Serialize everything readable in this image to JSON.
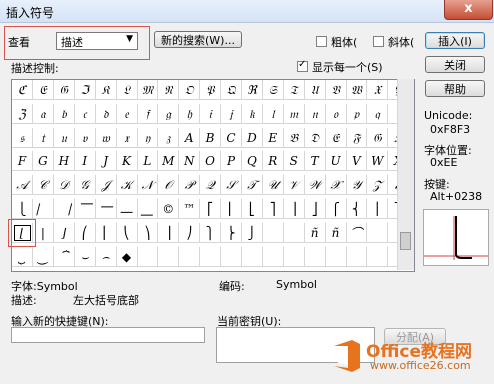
{
  "window": {
    "title": "插入符号",
    "close_glyph": "x"
  },
  "toolbar": {
    "view_label": "查看",
    "view_value": "描述",
    "new_search_label": "新的搜索(W)...",
    "bold_label": "粗体(",
    "italic_label": "斜体(",
    "insert_label": "插入(I)",
    "close_label": "关闭",
    "help_label": "帮助"
  },
  "grid_section": {
    "heading": "描述控制:",
    "show_one_label": "显示每一个(S)",
    "show_one_checked": true,
    "rows": [
      [
        "ℭ",
        "𝔈",
        "𝔊",
        "ℑ",
        "𝔎",
        "𝔏",
        "𝔐",
        "𝔑",
        "𝔒",
        "𝔓",
        "𝔔",
        "ℜ",
        "𝔖",
        "𝔗",
        "𝔘",
        "𝔙",
        "𝔚",
        "𝔛",
        "𝔜"
      ],
      [
        "ℨ",
        "𝔞",
        "𝔟",
        "𝔠",
        "𝔡",
        "𝔢",
        "𝔣",
        "𝔤",
        "𝔥",
        "𝔦",
        "𝔧",
        "𝔨",
        "𝔩",
        "𝔪",
        "𝔫",
        "𝔬",
        "𝔭",
        "𝔮",
        "𝔯"
      ],
      [
        "𝔰",
        "𝔱",
        "𝔲",
        "𝔳",
        "𝔴",
        "𝔵",
        "𝔶",
        "𝔷",
        "A",
        "B",
        "C",
        "D",
        "E",
        "𝔅",
        "𝔇",
        "𝔈",
        "𝔉",
        "𝔊",
        "ℌ"
      ],
      [
        "F",
        "G",
        "H",
        "I",
        "J",
        "K",
        "L",
        "M",
        "N",
        "O",
        "P",
        "Q",
        "R",
        "S",
        "T",
        "U",
        "V",
        "W",
        "X"
      ],
      [
        "𝒜",
        "𝒞",
        "𝒟",
        "𝒢",
        "𝒥",
        "𝒦",
        "𝒩",
        "𝒪",
        "𝒫",
        "𝒬",
        "𝒮",
        "𝒯",
        "𝒰",
        "𝒱",
        "𝒲",
        "𝒳",
        "𝒴",
        "𝒵",
        "𝒶"
      ],
      [
        "⎩",
        "⎸",
        "⎹",
        "⎺",
        "⎻",
        "⎼",
        "⎽",
        "©",
        "™",
        "⎡",
        "⎢",
        "⎣",
        "⎤",
        "⎥",
        "⎦",
        "⎧",
        "⎨",
        "⎪",
        "⎫"
      ],
      [
        "⌊",
        "|",
        "⌋",
        "⎛",
        "⎜",
        "⎝",
        "⎞",
        "⎟",
        "⎠",
        "⎫",
        "⎬",
        "⎭",
        "",
        "",
        "ñ",
        "ñ",
        "⌒",
        "",
        ""
      ],
      [
        "⏟",
        "⏝",
        "⏞",
        "⌣",
        "⌢",
        "◆",
        "",
        "",
        "",
        "",
        "",
        "",
        "",
        "",
        "",
        "",
        "",
        "",
        ""
      ]
    ],
    "selected": {
      "row": 6,
      "col": 0
    }
  },
  "details": {
    "font_label": "字体:Symbol",
    "code_label": "编码:",
    "code_value": "Symbol",
    "desc_label": "描述:",
    "desc_value": "左大括号底部",
    "unicode_label": "Unicode:",
    "unicode_value": "0xF8F3",
    "fontpos_label": "字体位置:",
    "fontpos_value": "0xEE",
    "key_label": "按键:",
    "key_value": "Alt+0238"
  },
  "shortcut": {
    "new_label": "输入新的快捷键(N):",
    "current_label": "当前密钥(U):",
    "assign_label": "分配(A)",
    "new_value": ""
  },
  "watermark": {
    "brand": "Office教程网",
    "url": "www.office26.com"
  },
  "colors": {
    "accent_red": "#d9534f",
    "logo_orange": "#e8731e"
  }
}
